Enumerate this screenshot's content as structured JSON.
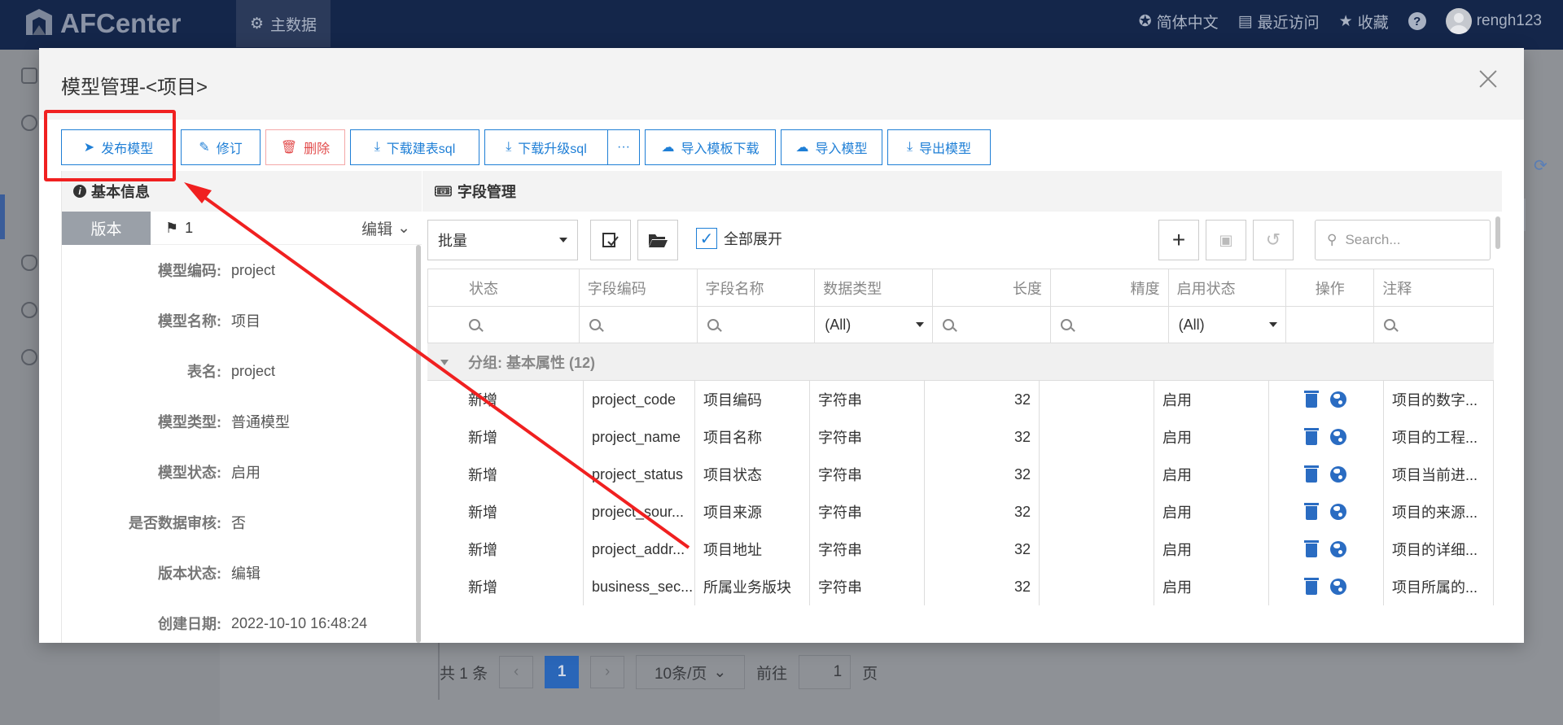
{
  "app": {
    "logo_text": "AFCenter",
    "nav_tab": "主数据",
    "language": "简体中文",
    "recent": "最近访问",
    "favorites": "收藏",
    "help": "?",
    "username": "rengh123"
  },
  "pager": {
    "total": "共 1 条",
    "prev": "‹",
    "current": "1",
    "next": "›",
    "page_size": "10条/页",
    "goto_label": "前往",
    "goto_value": "1",
    "page_unit": "页"
  },
  "modal": {
    "title": "模型管理-<项目>",
    "toolbar": {
      "publish": "发布模型",
      "revise": "修订",
      "delete": "删除",
      "download_create_sql": "下载建表sql",
      "download_upgrade_sql": "下载升级sql",
      "more": "···",
      "template_download": "导入模板下载",
      "import_model": "导入模型",
      "export_model": "导出模型"
    },
    "basic_info": {
      "title": "基本信息",
      "version_tab": "版本",
      "version_number": "1",
      "edit_label": "编辑",
      "rows": [
        {
          "label": "模型编码:",
          "value": "project"
        },
        {
          "label": "模型名称:",
          "value": "项目"
        },
        {
          "label": "表名:",
          "value": "project"
        },
        {
          "label": "模型类型:",
          "value": "普通模型"
        },
        {
          "label": "模型状态:",
          "value": "启用"
        },
        {
          "label": "是否数据审核:",
          "value": "否"
        },
        {
          "label": "版本状态:",
          "value": "编辑"
        },
        {
          "label": "创建日期:",
          "value": "2022-10-10 16:48:24"
        }
      ]
    },
    "fields": {
      "title": "字段管理",
      "batch": "批量",
      "expand_all": "全部展开",
      "search_placeholder": "Search...",
      "columns": [
        "状态",
        "字段编码",
        "字段名称",
        "数据类型",
        "长度",
        "精度",
        "启用状态",
        "操作",
        "注释"
      ],
      "filter_all": "(All)",
      "group_label": "分组: 基本属性 (12)",
      "rows": [
        {
          "status": "新增",
          "code": "project_code",
          "name": "项目编码",
          "type": "字符串",
          "length": "32",
          "precision": "",
          "enabled": "启用",
          "comment": "项目的数字..."
        },
        {
          "status": "新增",
          "code": "project_name",
          "name": "项目名称",
          "type": "字符串",
          "length": "32",
          "precision": "",
          "enabled": "启用",
          "comment": "项目的工程..."
        },
        {
          "status": "新增",
          "code": "project_status",
          "name": "项目状态",
          "type": "字符串",
          "length": "32",
          "precision": "",
          "enabled": "启用",
          "comment": "项目当前进..."
        },
        {
          "status": "新增",
          "code": "project_sour...",
          "name": "项目来源",
          "type": "字符串",
          "length": "32",
          "precision": "",
          "enabled": "启用",
          "comment": "项目的来源..."
        },
        {
          "status": "新增",
          "code": "project_addr...",
          "name": "项目地址",
          "type": "字符串",
          "length": "32",
          "precision": "",
          "enabled": "启用",
          "comment": "项目的详细..."
        },
        {
          "status": "新增",
          "code": "business_sec...",
          "name": "所属业务版块",
          "type": "字符串",
          "length": "32",
          "precision": "",
          "enabled": "启用",
          "comment": "项目所属的..."
        }
      ]
    }
  },
  "colors": {
    "topbar": "#14264a",
    "primary": "#1f7fd6",
    "danger": "#e24c4c",
    "annotation": "#f02020"
  }
}
